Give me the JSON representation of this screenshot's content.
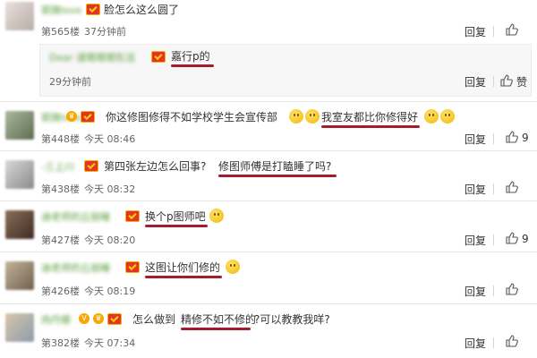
{
  "comments": [
    {
      "username": "郭旗love",
      "text": "脸怎么这么圆了",
      "floor": "第565楼",
      "time": "37分钟前",
      "reply": "回复",
      "likes": ""
    },
    {
      "username": "郭旗love",
      "text_a": "你这修图修得不如学校学生会宣传部",
      "text_b": "我室友都比你修得好",
      "floor": "第448楼",
      "time": "今天 08:46",
      "reply": "回复",
      "likes": "9"
    },
    {
      "username": "-三上川",
      "text_a": "第四张左边怎么回事?",
      "text_b": "修图师傅是打瞌睡了吗?",
      "floor": "第438楼",
      "time": "今天 08:32",
      "reply": "回复",
      "likes": ""
    },
    {
      "username": "迪老师的丘丽睡",
      "text": "换个p图师吧",
      "floor": "第427楼",
      "time": "今天 08:20",
      "reply": "回复",
      "likes": "9"
    },
    {
      "username": "迪老师的丘丽睡",
      "text": "这图让你们修的",
      "floor": "第426楼",
      "time": "今天 08:19",
      "reply": "回复",
      "likes": ""
    },
    {
      "username": "肉丹娜",
      "text_a": "怎么做到",
      "text_b": "精修不如不修的",
      "text_c": "?可以教教我咩?",
      "floor": "第382楼",
      "time": "今天 07:34",
      "reply": "回复",
      "likes": ""
    }
  ],
  "nested_reply": {
    "username": "Dear 请嗯嗯嗯形洁",
    "text": "嘉行p的",
    "time": "29分钟前",
    "reply": "回复",
    "like_label": "赞"
  },
  "colors": {
    "underline": "#a31d2d",
    "username": "#5a9e3c",
    "badge": "#e6332a"
  },
  "icons": [
    "thumb-up-icon",
    "vip-badge-icon",
    "crown-badge-icon",
    "smiley-emoji-icon"
  ]
}
